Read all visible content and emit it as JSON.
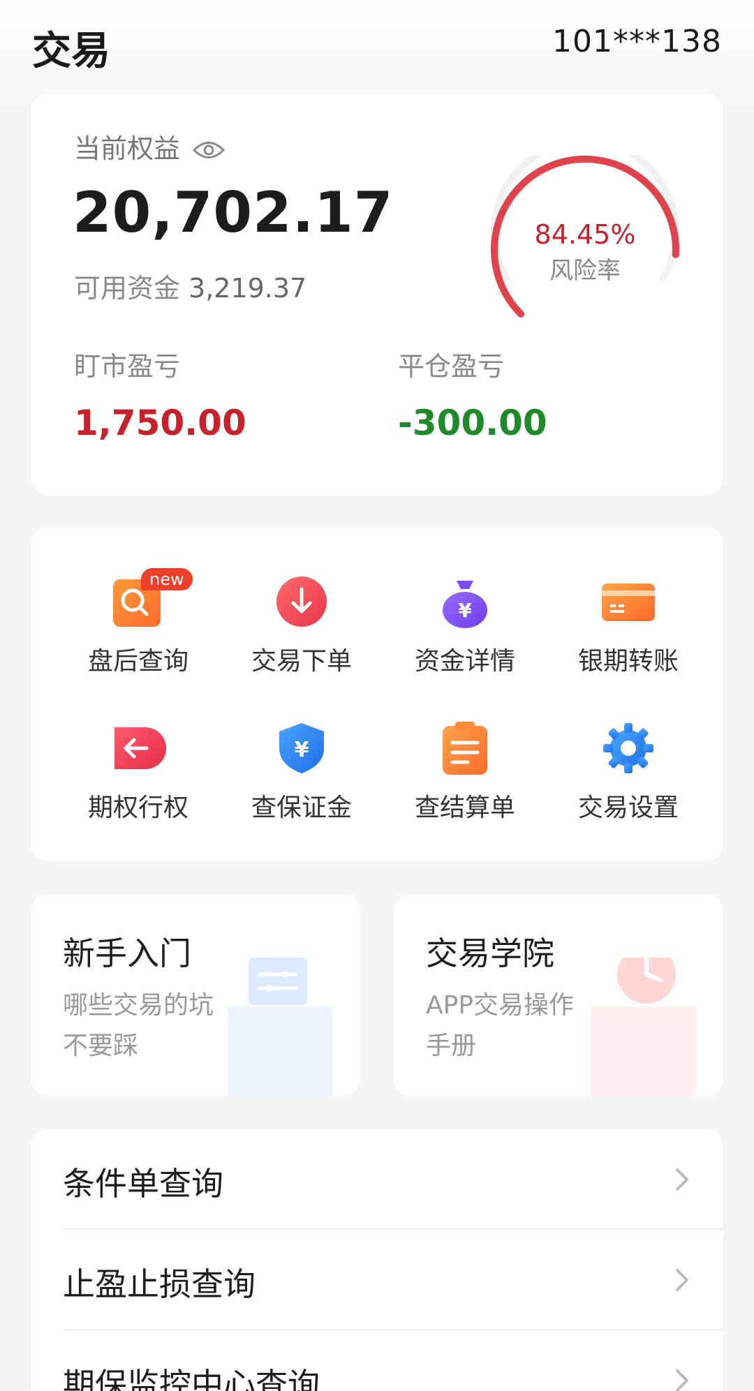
{
  "header": {
    "title": "交易",
    "account": "101***138"
  },
  "equity": {
    "label": "当前权益",
    "value": "20,702.17",
    "available_label": "可用资金",
    "available_value": "3,219.37",
    "risk_rate": "84.45%",
    "risk_rate_value": 84.45,
    "risk_label": "风险率",
    "floating_pnl_label": "盯市盈亏",
    "floating_pnl_value": "1,750.00",
    "close_pnl_label": "平仓盈亏",
    "close_pnl_value": "-300.00"
  },
  "functions": [
    {
      "label": "盘后查询",
      "icon": "search-icon",
      "badge": "new"
    },
    {
      "label": "交易下单",
      "icon": "download-arrow-icon"
    },
    {
      "label": "资金详情",
      "icon": "money-bag-icon"
    },
    {
      "label": "银期转账",
      "icon": "bank-card-icon"
    },
    {
      "label": "期权行权",
      "icon": "arrow-left-icon"
    },
    {
      "label": "查保证金",
      "icon": "shield-yuan-icon"
    },
    {
      "label": "查结算单",
      "icon": "clipboard-icon"
    },
    {
      "label": "交易设置",
      "icon": "gear-icon"
    }
  ],
  "cards": {
    "beginner": {
      "title": "新手入门",
      "subtitle": "哪些交易的坑不要踩"
    },
    "academy": {
      "title": "交易学院",
      "subtitle": "APP交易操作手册"
    }
  },
  "list": [
    {
      "label": "条件单查询"
    },
    {
      "label": "止盈止损查询"
    },
    {
      "label": "期保监控中心查询"
    }
  ],
  "colors": {
    "red": "#c8212b",
    "green": "#1e8a2a",
    "gauge_red": "#e0434c"
  }
}
